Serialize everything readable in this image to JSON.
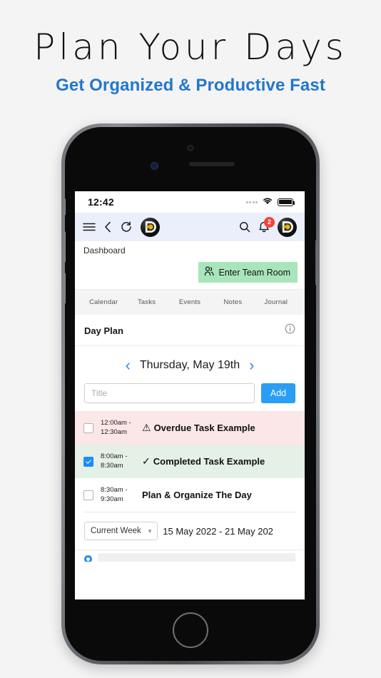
{
  "promo": {
    "title": "Plan Your Days",
    "subtitle": "Get Organized & Productive Fast",
    "title_color": "#111111",
    "subtitle_color": "#2277cc"
  },
  "status_bar": {
    "time": "12:42",
    "wifi_icon": "wifi-icon",
    "battery_icon": "battery-full-icon",
    "signal_icon": "signal-dots-icon"
  },
  "nav_bar": {
    "menu_icon": "hamburger-menu-icon",
    "back_icon": "chevron-left-icon",
    "refresh_icon": "refresh-icon",
    "logo_letter": "D",
    "search_icon": "search-icon",
    "bell_icon": "bell-icon",
    "notification_count": "2",
    "avatar_letter": "D",
    "background_color": "#eaeffb"
  },
  "breadcrumb": {
    "label": "Dashboard"
  },
  "team_room": {
    "label": "Enter Team Room",
    "icon": "people-icon",
    "background_color": "#a9e5bb"
  },
  "tabs": [
    {
      "label": "Calendar"
    },
    {
      "label": "Tasks"
    },
    {
      "label": "Events"
    },
    {
      "label": "Notes"
    },
    {
      "label": "Journal"
    }
  ],
  "day_plan": {
    "title": "Day Plan",
    "info_icon": "info-circle-icon",
    "prev_icon": "chevron-left-icon",
    "next_icon": "chevron-right-icon",
    "date": "Thursday, May 19th",
    "input_placeholder": "Title",
    "input_value": "",
    "add_label": "Add",
    "add_color": "#2a9df4",
    "tasks": [
      {
        "time": "12:00am -\n12:30am",
        "time_start": "12:00am -",
        "time_end": "12:30am",
        "glyph": "⚠",
        "glyph_name": "warning-triangle-icon",
        "label": "Overdue Task Example",
        "checked": false,
        "state": "overdue",
        "background_color": "#fbe7e7"
      },
      {
        "time_start": "8:00am -",
        "time_end": "8:30am",
        "glyph": "✓",
        "glyph_name": "check-icon",
        "label": "Completed Task Example",
        "checked": true,
        "state": "completed",
        "background_color": "#e5f0e6"
      },
      {
        "time_start": "8:30am -",
        "time_end": "9:30am",
        "glyph": "",
        "glyph_name": "none",
        "label": "Plan & Organize The Day",
        "checked": false,
        "state": "normal",
        "background_color": "#ffffff"
      }
    ]
  },
  "week_section": {
    "select_value": "Current Week",
    "select_icon": "chevron-down-icon",
    "range": "15 May 2022 - 21 May 202",
    "radio_icon": "radio-selected-icon"
  }
}
